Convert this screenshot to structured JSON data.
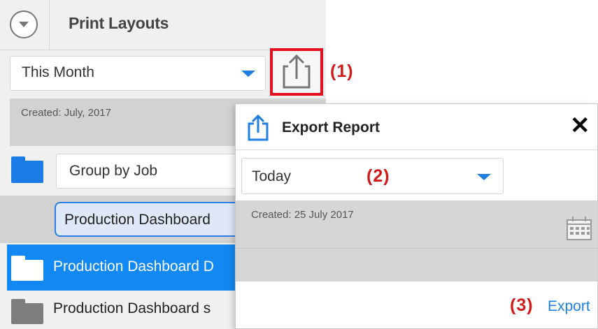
{
  "left_panel": {
    "header": {
      "title": "Print Layouts",
      "collapse_icon": "chevron-down-circle-icon"
    },
    "period_select": {
      "value": "This Month"
    },
    "share_icon": "share-export-icon",
    "created": "Created: July, 2017",
    "group_select": {
      "value": "Group by Job"
    },
    "filter_input": {
      "value": "Production Dashboard"
    },
    "items": [
      {
        "label": "Production Dashboard D",
        "selected": true,
        "icon": "folder-icon"
      },
      {
        "label": "Production Dashboard s",
        "selected": false,
        "icon": "folder-icon"
      }
    ]
  },
  "annotations": {
    "one": "(1)",
    "two": "(2)",
    "three": "(3)"
  },
  "dialog": {
    "title": "Export Report",
    "title_icon": "export-icon",
    "close_label": "✕",
    "period_select": {
      "value": "Today"
    },
    "created": "Created: 25 July 2017",
    "calendar_icon": "calendar-icon",
    "export_label": "Export"
  },
  "colors": {
    "accent": "#1e7fe0",
    "selected_row": "#1288f2",
    "annotation": "#d31a1a",
    "highlight_box": "#e3101e"
  }
}
